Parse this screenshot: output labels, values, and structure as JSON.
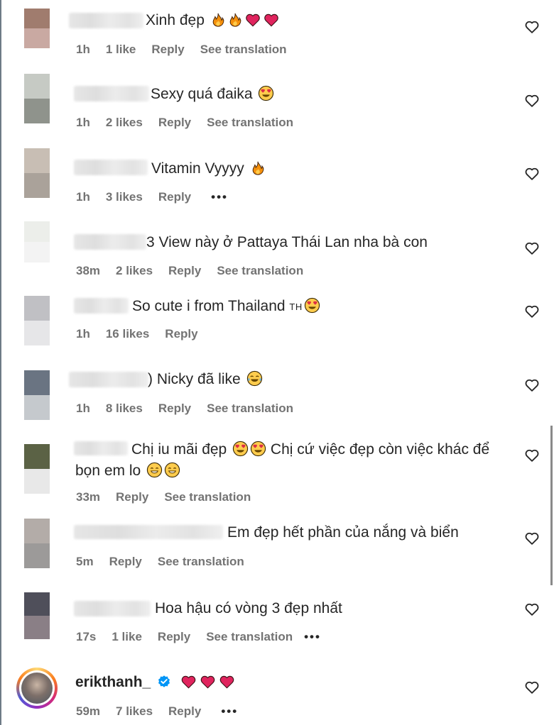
{
  "comments": [
    {
      "text": "Xinh đẹp",
      "emojis": [
        "fire",
        "fire",
        "red-heart",
        "red-heart"
      ],
      "time": "1h",
      "likes": "1 like",
      "reply": "Reply",
      "translate": "See translation",
      "avatar_colors": [
        "#a07c6e",
        "#c9a9a2"
      ]
    },
    {
      "text": "Sexy quá đaika",
      "emojis": [
        "heart-eyes"
      ],
      "time": "1h",
      "likes": "2 likes",
      "reply": "Reply",
      "translate": "See translation",
      "avatar_colors": [
        "#c6cac4",
        "#8f938c"
      ]
    },
    {
      "text": "Vitamin Vyyyy",
      "emojis": [
        "fire"
      ],
      "time": "1h",
      "likes": "3 likes",
      "reply": "Reply",
      "more": "•••",
      "avatar_colors": [
        "#c8beb4",
        "#aaa29a"
      ]
    },
    {
      "text": "3 View này ở Pattaya Thái Lan nha bà con",
      "emojis": [],
      "time": "38m",
      "likes": "2 likes",
      "reply": "Reply",
      "translate": "See translation",
      "avatar_colors": [
        "#eceeea",
        "#f3f3f3"
      ]
    },
    {
      "text": "So cute i from Thailand",
      "flag": "TH",
      "emojis": [
        "heart-eyes"
      ],
      "time": "1h",
      "likes": "16 likes",
      "reply": "Reply",
      "avatar_colors": [
        "#c0c0c4",
        "#e6e6e8"
      ]
    },
    {
      "text": ") Nicky đã like",
      "emojis": [
        "tears-of-joy"
      ],
      "time": "1h",
      "likes": "8 likes",
      "reply": "Reply",
      "translate": "See translation",
      "avatar_colors": [
        "#6a7482",
        "#c5c9cd"
      ]
    },
    {
      "text_line1": "Chị iu mãi đẹp",
      "text_line1b": "Chị cứ việc đẹp còn việc khác để",
      "text_line2": "bọn em lo",
      "emojis_a": [
        "heart-eyes",
        "heart-eyes"
      ],
      "emojis_b": [
        "smiling-eyes",
        "smiling-eyes"
      ],
      "time": "33m",
      "reply": "Reply",
      "translate": "See translation",
      "avatar_colors": [
        "#5b6245",
        "#e8e8e8"
      ]
    },
    {
      "text": "Em đẹp hết phần của nắng và biển",
      "emojis": [],
      "time": "5m",
      "reply": "Reply",
      "translate": "See translation",
      "avatar_colors": [
        "#b3aca8",
        "#9c9a99"
      ]
    },
    {
      "text": "Hoa hậu có vòng 3 đẹp nhất",
      "emojis": [],
      "time": "17s",
      "likes": "1 like",
      "reply": "Reply",
      "translate": "See translation",
      "more": "•••",
      "avatar_colors": [
        "#4f4f5a",
        "#8a7f86"
      ]
    },
    {
      "username": "erikthanh_",
      "verified": true,
      "emojis": [
        "red-heart",
        "red-heart",
        "red-heart"
      ],
      "time": "59m",
      "likes": "7 likes",
      "reply": "Reply",
      "more": "•••"
    }
  ],
  "icons": {
    "like": "heart-outline-icon",
    "verified": "verified-badge-icon",
    "more": "more-dots-icon"
  },
  "colors": {
    "text": "#262626",
    "meta": "#737373",
    "verified": "#0095f6",
    "heart_red": "#e0245e"
  }
}
